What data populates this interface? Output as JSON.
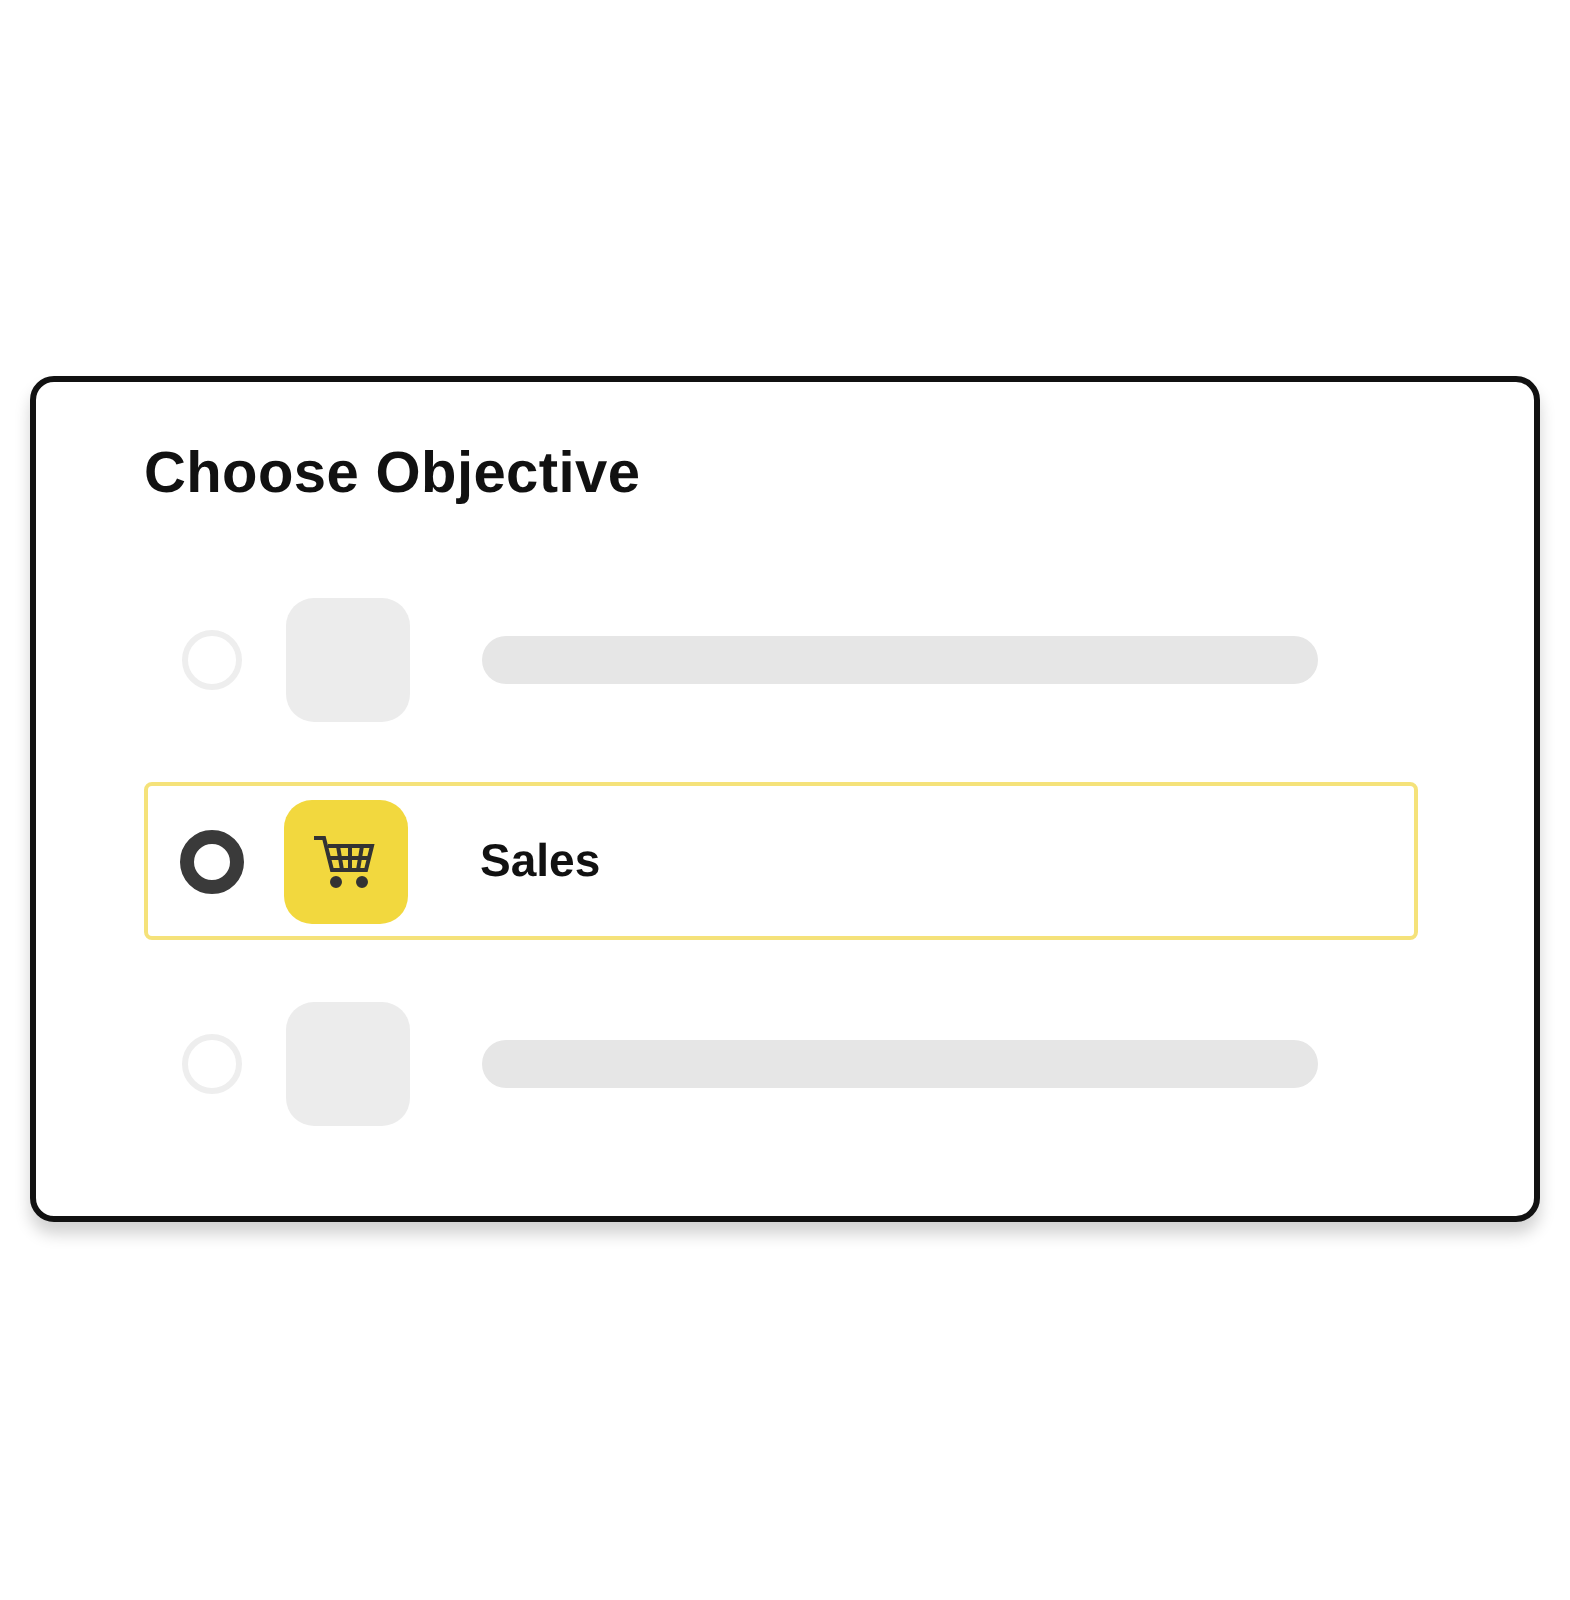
{
  "title": "Choose Objective",
  "options": [
    {
      "kind": "placeholder",
      "selected": false
    },
    {
      "kind": "option",
      "label": "Sales",
      "selected": true
    },
    {
      "kind": "placeholder",
      "selected": false
    }
  ]
}
